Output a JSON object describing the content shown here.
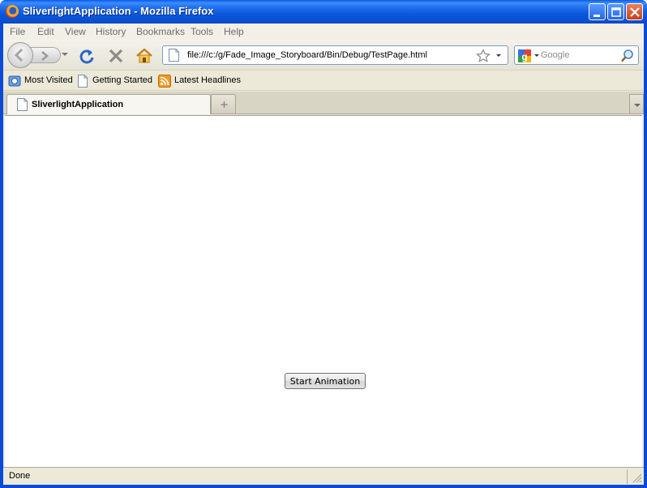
{
  "window": {
    "title": "SliverlightApplication - Mozilla Firefox",
    "app_icon": "firefox-icon",
    "buttons": [
      "minimize-icon",
      "maximize-icon",
      "close-icon"
    ]
  },
  "menubar": {
    "items": [
      {
        "label": "File",
        "key": "file"
      },
      {
        "label": "Edit",
        "key": "edit"
      },
      {
        "label": "View",
        "key": "view"
      },
      {
        "label": "History",
        "key": "history"
      },
      {
        "label": "Bookmarks",
        "key": "bookmarks"
      },
      {
        "label": "Tools",
        "key": "tools"
      },
      {
        "label": "Help",
        "key": "help"
      }
    ]
  },
  "navbar": {
    "url": "file:///c:/g/Fade_Image_Storyboard/Bin/Debug/TestPage.html",
    "search_placeholder": "Google",
    "icons": [
      "back-icon",
      "forward-icon",
      "reload-icon",
      "stop-icon",
      "home-icon",
      "bookmark-star-icon",
      "google-icon",
      "magnifier-icon"
    ]
  },
  "bookmarks": {
    "items": [
      {
        "label": "Most Visited",
        "icon": "most-visited-icon"
      },
      {
        "label": "Getting Started",
        "icon": "page-icon"
      },
      {
        "label": "Latest Headlines",
        "icon": "rss-feed-icon"
      }
    ]
  },
  "tabs": {
    "active": {
      "label": "SliverlightApplication",
      "icon": "page-icon"
    }
  },
  "content": {
    "button_label": "Start Animation"
  },
  "statusbar": {
    "text": "Done"
  },
  "colors": {
    "titlebar": "#0a57dd",
    "chrome": "#ece9d8",
    "content_bg": "#ffffff"
  }
}
